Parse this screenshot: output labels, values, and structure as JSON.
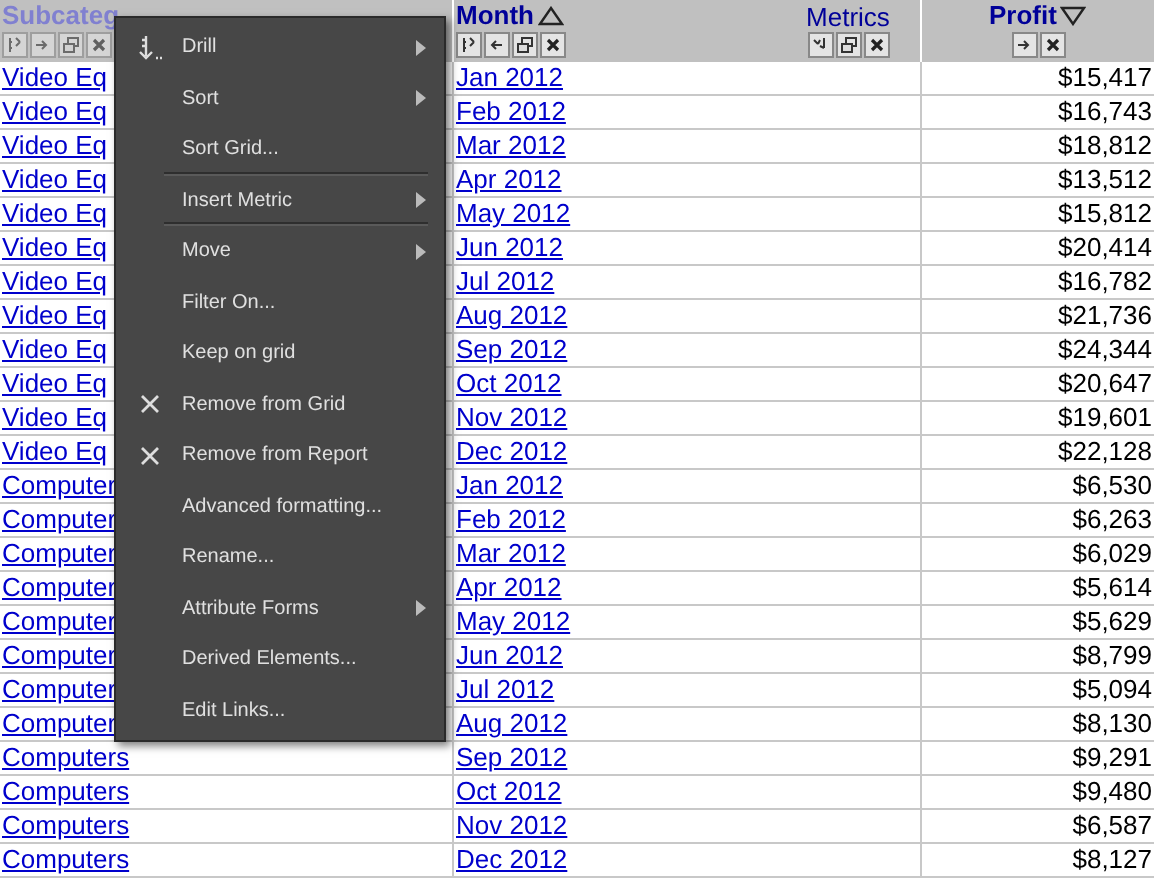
{
  "columns": [
    {
      "label": "Subcateg",
      "highlighted": true,
      "sorted_ascending": false,
      "sorted_descending": false
    },
    {
      "label": "Month",
      "highlighted": false,
      "sorted_ascending": true,
      "sorted_descending": false
    },
    {
      "label": "Metrics",
      "highlighted": false,
      "sorted_ascending": false,
      "sorted_descending": false
    },
    {
      "label": "Profit",
      "highlighted": false,
      "sorted_ascending": false,
      "sorted_descending": true
    }
  ],
  "rows": [
    [
      "Video Eq",
      "Jan 2012",
      "$15,417"
    ],
    [
      "Video Eq",
      "Feb 2012",
      "$16,743"
    ],
    [
      "Video Eq",
      "Mar 2012",
      "$18,812"
    ],
    [
      "Video Eq",
      "Apr 2012",
      "$13,512"
    ],
    [
      "Video Eq",
      "May 2012",
      "$15,812"
    ],
    [
      "Video Eq",
      "Jun 2012",
      "$20,414"
    ],
    [
      "Video Eq",
      "Jul 2012",
      "$16,782"
    ],
    [
      "Video Eq",
      "Aug 2012",
      "$21,736"
    ],
    [
      "Video Eq",
      "Sep 2012",
      "$24,344"
    ],
    [
      "Video Eq",
      "Oct 2012",
      "$20,647"
    ],
    [
      "Video Eq",
      "Nov 2012",
      "$19,601"
    ],
    [
      "Video Eq",
      "Dec 2012",
      "$22,128"
    ],
    [
      "Computer",
      "Jan 2012",
      "$6,530"
    ],
    [
      "Computer",
      "Feb 2012",
      "$6,263"
    ],
    [
      "Computer",
      "Mar 2012",
      "$6,029"
    ],
    [
      "Computer",
      "Apr 2012",
      "$5,614"
    ],
    [
      "Computer",
      "May 2012",
      "$5,629"
    ],
    [
      "Computer",
      "Jun 2012",
      "$8,799"
    ],
    [
      "Computer",
      "Jul 2012",
      "$5,094"
    ],
    [
      "Computer",
      "Aug 2012",
      "$8,130"
    ],
    [
      "Computers",
      "Sep 2012",
      "$9,291"
    ],
    [
      "Computers",
      "Oct 2012",
      "$9,480"
    ],
    [
      "Computers",
      "Nov 2012",
      "$6,587"
    ],
    [
      "Computers",
      "Dec 2012",
      "$8,127"
    ]
  ],
  "context_menu": [
    {
      "label": "Drill",
      "kind": "drill",
      "submenu": true,
      "separator_after": false
    },
    {
      "label": "Sort",
      "kind": "plain",
      "submenu": true,
      "separator_after": false
    },
    {
      "label": "Sort Grid...",
      "kind": "plain",
      "submenu": false,
      "separator_after": true
    },
    {
      "label": "Insert Metric",
      "kind": "plain",
      "submenu": true,
      "separator_after": true
    },
    {
      "label": "Move",
      "kind": "plain",
      "submenu": true,
      "separator_after": false
    },
    {
      "label": "Filter On...",
      "kind": "plain",
      "submenu": false,
      "separator_after": false
    },
    {
      "label": "Keep on grid",
      "kind": "plain",
      "submenu": false,
      "separator_after": false
    },
    {
      "label": "Remove from Grid",
      "kind": "remove",
      "submenu": false,
      "separator_after": false
    },
    {
      "label": "Remove from Report",
      "kind": "remove",
      "submenu": false,
      "separator_after": false
    },
    {
      "label": "Advanced formatting...",
      "kind": "plain",
      "submenu": false,
      "separator_after": false
    },
    {
      "label": "Rename...",
      "kind": "plain",
      "submenu": false,
      "separator_after": false
    },
    {
      "label": "Attribute Forms",
      "kind": "plain",
      "submenu": true,
      "separator_after": false
    },
    {
      "label": "Derived Elements...",
      "kind": "plain",
      "submenu": false,
      "separator_after": false
    },
    {
      "label": "Edit Links...",
      "kind": "plain",
      "submenu": false,
      "separator_after": false
    }
  ]
}
